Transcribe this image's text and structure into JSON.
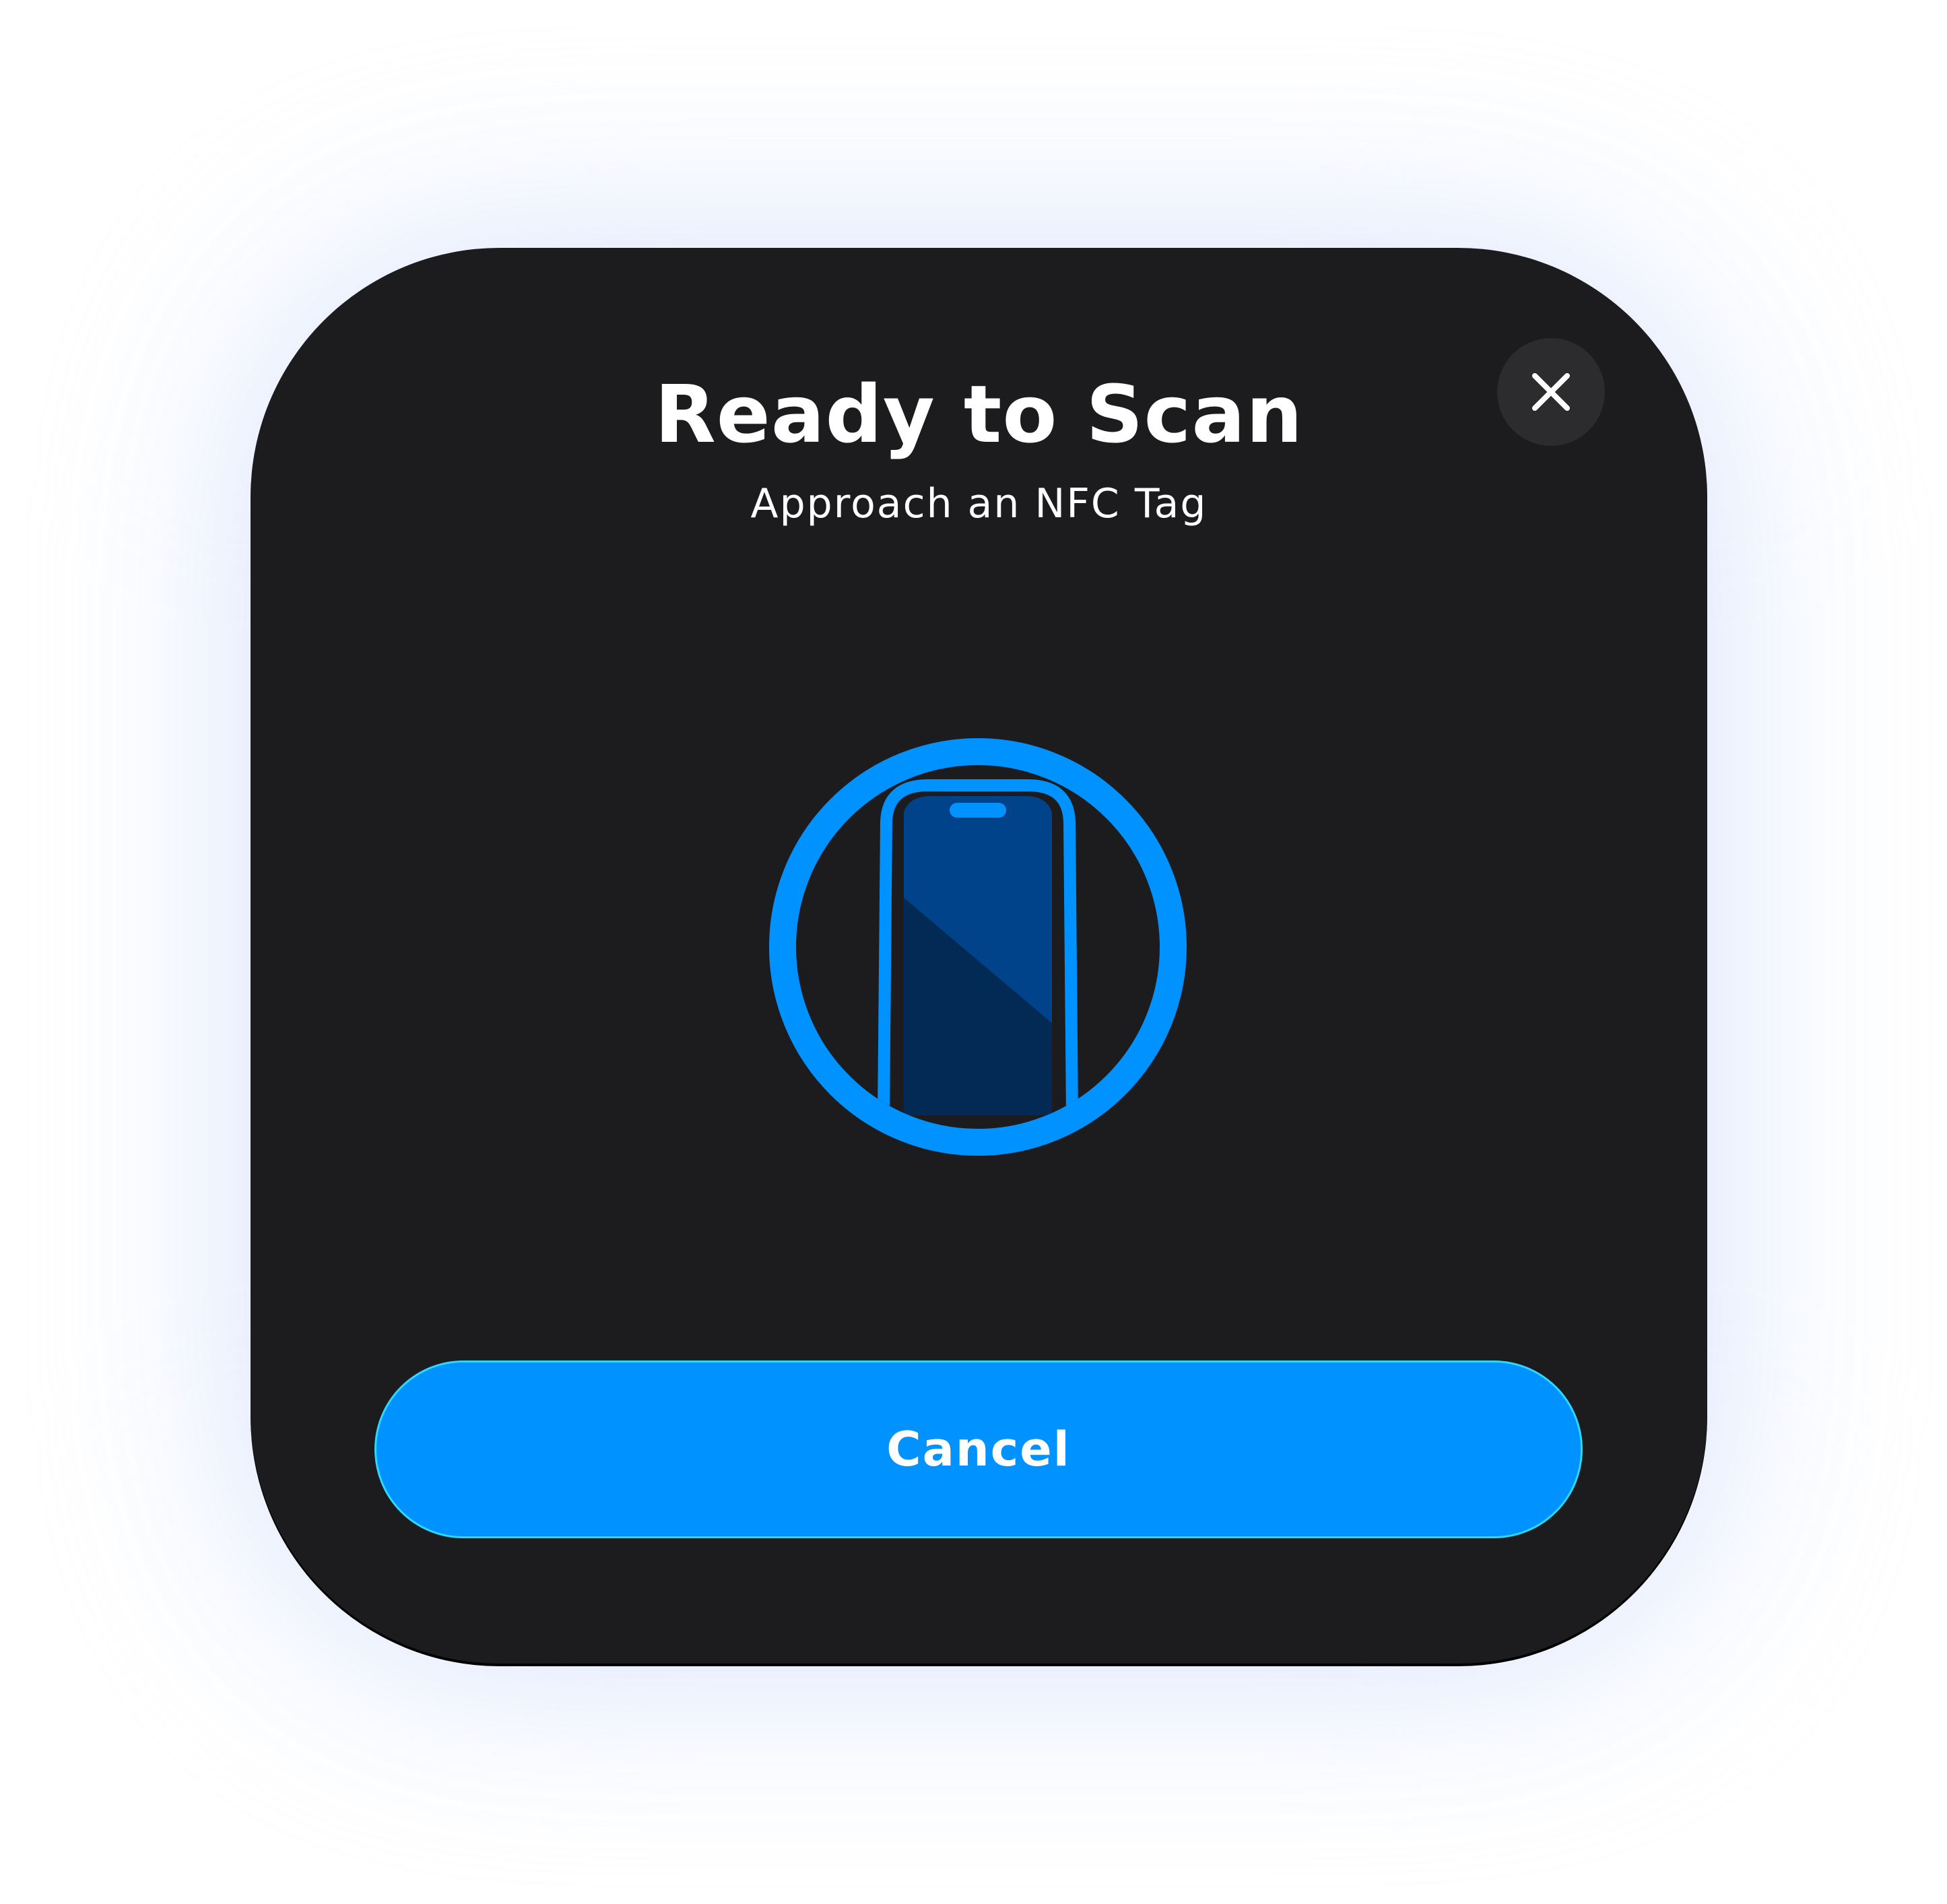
{
  "dialog": {
    "title": "Ready to Scan",
    "subtitle": "Approach an NFC Tag",
    "close_icon": "close-icon",
    "scan_icon": "phone-nfc-icon",
    "cancel_label": "Cancel"
  },
  "colors": {
    "card_background": "#1c1c1e",
    "close_button_background": "#2c2c2e",
    "accent": "#0092ff",
    "phone_screen_light": "#00438a",
    "phone_screen_dark": "#022a55",
    "glow": "#cfdcfb"
  }
}
